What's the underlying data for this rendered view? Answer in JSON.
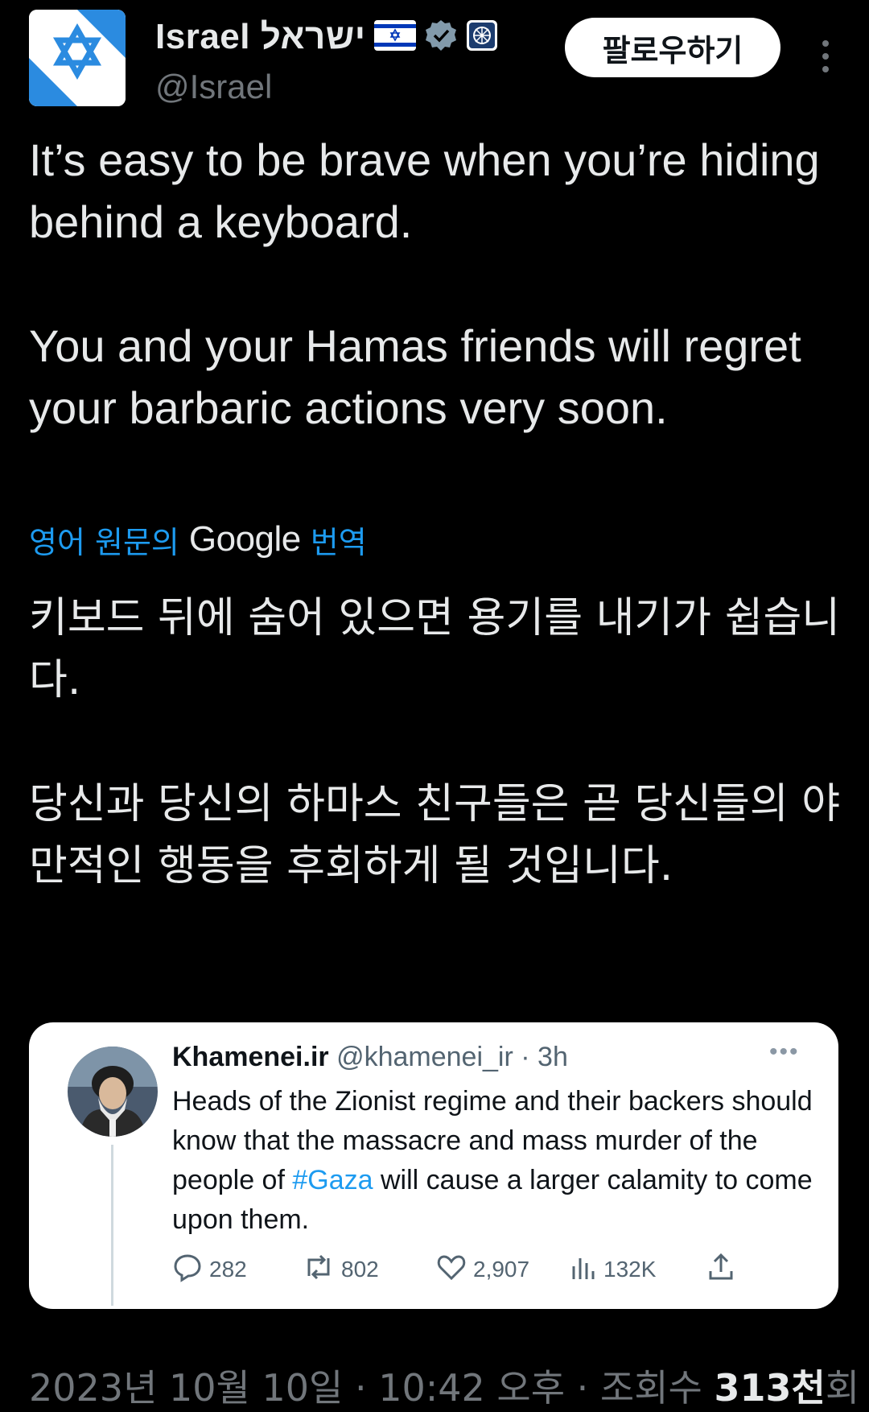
{
  "author": {
    "display_name": "Israel ישראל",
    "handle": "@Israel",
    "flag_icon": "israel-flag-icon",
    "verified_icon": "verified-badge-icon",
    "affiliation_icon": "government-affiliation-icon"
  },
  "follow_label": "팔로우하기",
  "tweet": {
    "paragraphs": [
      "It’s easy to be brave when you’re hiding behind a keyboard.",
      "You and your Hamas friends will regret your barbaric actions very soon."
    ]
  },
  "translation": {
    "prefix": "영어 원문의",
    "brand": "Google",
    "suffix": "번역",
    "paragraphs": [
      "키보드 뒤에 숨어 있으면 용기를 내기가 쉽습니다.",
      "당신과 당신의 하마스 친구들은 곧 당신들의 야만적인 행동을 후회하게 될 것입니다."
    ]
  },
  "quoted_tweet": {
    "name": "Khamenei.ir",
    "handle": "@khamenei_ir",
    "time": "3h",
    "text_before": "Heads of the Zionist regime and their backers should know that the massacre and mass murder of the people of ",
    "hashtag": "#Gaza",
    "text_after": " will cause a larger calamity to come upon them.",
    "replies": "282",
    "retweets": "802",
    "likes": "2,907",
    "views": "132K"
  },
  "meta": {
    "date": "2023년 10월 10일",
    "time": "10:42 오후",
    "views_label": "조회수",
    "views_count": "313천",
    "views_unit": "회"
  },
  "colors": {
    "background": "#000000",
    "text": "#e7e9ea",
    "muted": "#71767b",
    "link": "#1d9bf0",
    "flag_blue": "#0038b8"
  }
}
